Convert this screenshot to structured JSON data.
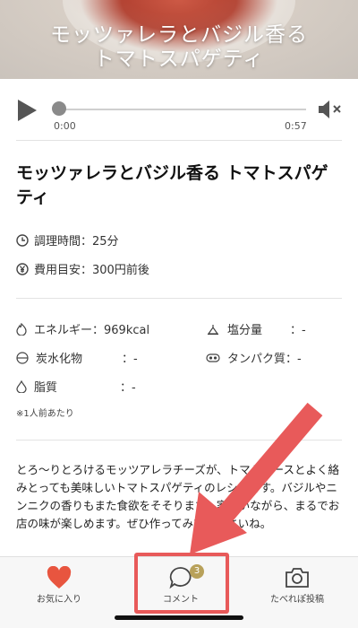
{
  "hero": {
    "overlay_title_line1": "モッツァレラとバジル香る",
    "overlay_title_line2": "トマトスパゲティ"
  },
  "player": {
    "time_current": "0:00",
    "time_total": "0:57",
    "progress": 0.0,
    "play_icon": "play-icon",
    "mute_icon": "speaker-muted-icon"
  },
  "recipe": {
    "title": "モッツァレラとバジル香る トマトスパゲティ",
    "cook_time": "調理時間：25分",
    "cost": "費用目安：300円前後"
  },
  "nutrition": {
    "energy_label": "エネルギー",
    "energy_value": "：969kcal",
    "salt_label": "塩分量",
    "salt_value": "：-",
    "carbs_label": "炭水化物",
    "carbs_value": "：-",
    "protein_label": "タンパク質",
    "protein_value": "：-",
    "fat_label": "脂質",
    "fat_value": "：-",
    "note": "※1人前あたり"
  },
  "description": {
    "text": "とろ〜りとろけるモッツアレラチーズが、トマトソースとよく絡みとっても美味しいトマトスパゲティのレシピです。バジルやニンニクの香りもまた食欲をそそります。家にいながら、まるでお店の味が楽しめます。ぜひ作ってみてくださいね。"
  },
  "tabbar": {
    "favorites_label": "お気に入り",
    "comments_label": "コメント",
    "comments_badge": "3",
    "post_label": "たべれぽ投稿"
  },
  "colors": {
    "heart": "#e8553f",
    "badge": "#b8a15a",
    "annotation": "#e85a5a"
  }
}
